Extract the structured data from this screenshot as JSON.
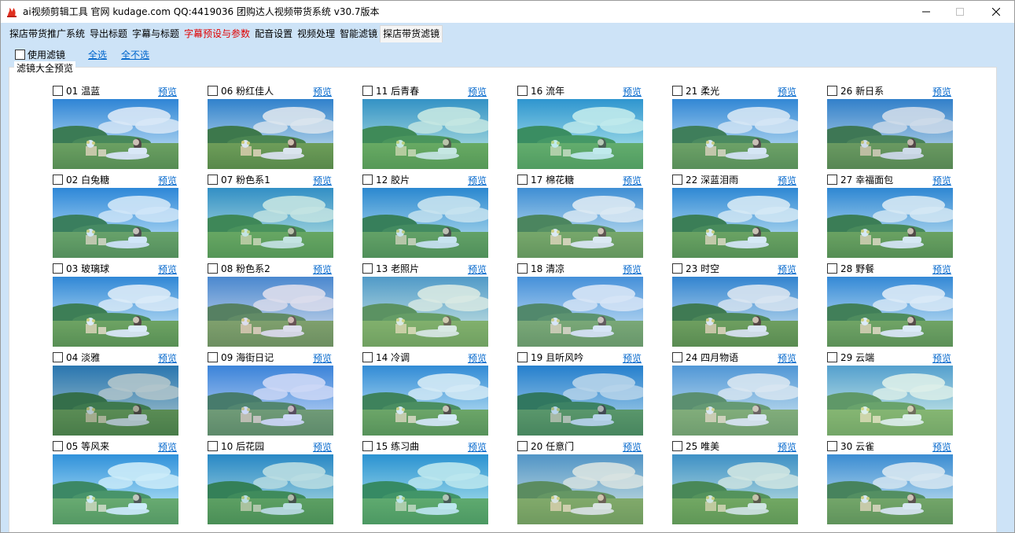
{
  "window": {
    "title": "ai视频剪辑工具 官网 kudage.com QQ:4419036     团购达人视频带货系统    v30.7版本",
    "controls": {
      "minimize": "minimize-icon",
      "maximize": "maximize-icon",
      "close": "close-icon"
    }
  },
  "tabs": [
    {
      "label": "探店带货推广系统",
      "active": false,
      "highlight": false
    },
    {
      "label": "导出标题",
      "active": false,
      "highlight": false
    },
    {
      "label": "字幕与标题",
      "active": false,
      "highlight": false
    },
    {
      "label": "字幕预设与参数",
      "active": false,
      "highlight": true
    },
    {
      "label": "配音设置",
      "active": false,
      "highlight": false
    },
    {
      "label": "视频处理",
      "active": false,
      "highlight": false
    },
    {
      "label": "智能滤镜",
      "active": false,
      "highlight": false
    },
    {
      "label": "探店带货滤镜",
      "active": true,
      "highlight": false
    }
  ],
  "toolbar": {
    "use_filter_label": "使用滤镜",
    "use_filter_checked": false,
    "select_all": "全选",
    "select_none": "全不选"
  },
  "panel": {
    "legend": "滤镜大全预览",
    "preview_label": "预览"
  },
  "filters": [
    {
      "label": "01 温蓝",
      "tint": "#2f7fd0",
      "strength": 0.18
    },
    {
      "label": "02 白兔糖",
      "tint": "#2a8ee0",
      "strength": 0.22
    },
    {
      "label": "03 玻璃球",
      "tint": "#3a8fd8",
      "strength": 0.18
    },
    {
      "label": "04 淡雅",
      "tint": "#1f5a6a",
      "strength": 0.35
    },
    {
      "label": "05 等风来",
      "tint": "#35b5e8",
      "strength": 0.25
    },
    {
      "label": "06 粉红佳人",
      "tint": "#3a6ea0",
      "strength": 0.18
    },
    {
      "label": "07 粉色系1",
      "tint": "#3aa7a0",
      "strength": 0.3
    },
    {
      "label": "08 粉色系2",
      "tint": "#8a8fc0",
      "strength": 0.3
    },
    {
      "label": "09 海街日记",
      "tint": "#5a7fe0",
      "strength": 0.3
    },
    {
      "label": "10 后花园",
      "tint": "#1a8f9f",
      "strength": 0.3
    },
    {
      "label": "11 后青春",
      "tint": "#3fb0a0",
      "strength": 0.3
    },
    {
      "label": "12 胶片",
      "tint": "#1f8fc0",
      "strength": 0.25
    },
    {
      "label": "13 老照片",
      "tint": "#8fbfb0",
      "strength": 0.35
    },
    {
      "label": "14 冷调",
      "tint": "#3a9fd8",
      "strength": 0.22
    },
    {
      "label": "15 练习曲",
      "tint": "#20b0c8",
      "strength": 0.3
    },
    {
      "label": "16 流年",
      "tint": "#30b8c0",
      "strength": 0.3
    },
    {
      "label": "17 棉花糖",
      "tint": "#6fa8d0",
      "strength": 0.25
    },
    {
      "label": "18 清凉",
      "tint": "#7aa8e0",
      "strength": 0.3
    },
    {
      "label": "19 且听风吟",
      "tint": "#0f70b8",
      "strength": 0.3
    },
    {
      "label": "20 任意门",
      "tint": "#8fb0a8",
      "strength": 0.35
    },
    {
      "label": "21 柔光",
      "tint": "#3f8fd0",
      "strength": 0.22
    },
    {
      "label": "22 深蓝泪雨",
      "tint": "#2f8fcf",
      "strength": 0.2
    },
    {
      "label": "23 时空",
      "tint": "#3f7fb8",
      "strength": 0.2
    },
    {
      "label": "24 四月物语",
      "tint": "#8fb8d8",
      "strength": 0.35
    },
    {
      "label": "25 唯美",
      "tint": "#5fa8a0",
      "strength": 0.3
    },
    {
      "label": "26 新日系",
      "tint": "#3a6fa8",
      "strength": 0.25
    },
    {
      "label": "27 幸福面包",
      "tint": "#2f8ac8",
      "strength": 0.2
    },
    {
      "label": "28 野餐",
      "tint": "#4a98d8",
      "strength": 0.2
    },
    {
      "label": "29 云端",
      "tint": "#9ad0c0",
      "strength": 0.35
    },
    {
      "label": "30 云雀",
      "tint": "#5fa0c8",
      "strength": 0.25
    }
  ],
  "layout_grid": {
    "rows": 5,
    "cols": 6
  }
}
